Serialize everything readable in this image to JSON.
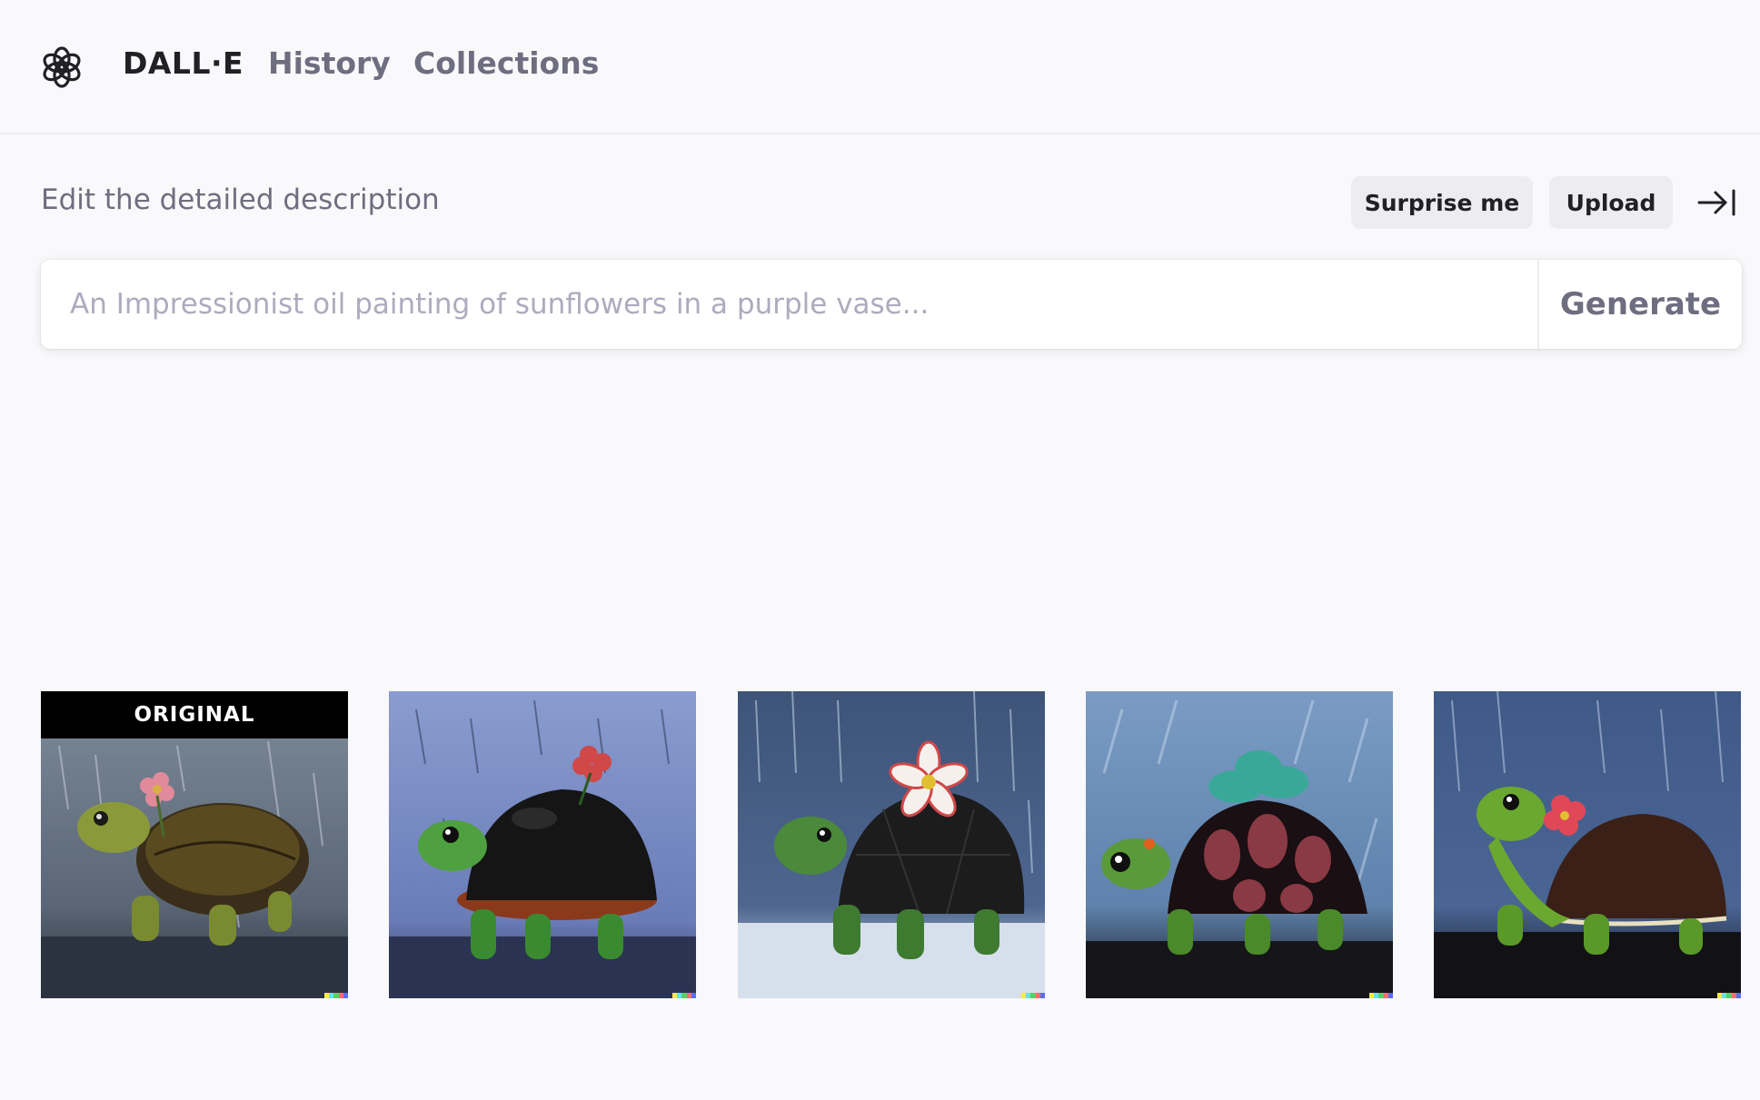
{
  "nav": {
    "brand": "DALL·E",
    "history": "History",
    "collections": "Collections"
  },
  "editor": {
    "label": "Edit the detailed description",
    "surprise_label": "Surprise me",
    "upload_label": "Upload",
    "placeholder": "An Impressionist oil painting of sunflowers in a purple vase...",
    "generate_label": "Generate"
  },
  "gallery": {
    "original_badge": "ORIGINAL",
    "images": [
      {
        "subject": "turtle-in-rain-original",
        "is_original": true
      },
      {
        "subject": "turtle-variation-1",
        "is_original": false
      },
      {
        "subject": "turtle-variation-2",
        "is_original": false
      },
      {
        "subject": "turtle-variation-3",
        "is_original": false
      },
      {
        "subject": "turtle-variation-4",
        "is_original": false
      }
    ]
  },
  "colors": {
    "background": "#f9f9fb",
    "text_primary": "#202123",
    "text_secondary": "#6e6e80",
    "button_bg": "#ececf1",
    "placeholder": "#acacbe"
  },
  "icons": {
    "logo": "openai-logo-icon",
    "collapse": "arrow-right-to-bar-icon"
  }
}
